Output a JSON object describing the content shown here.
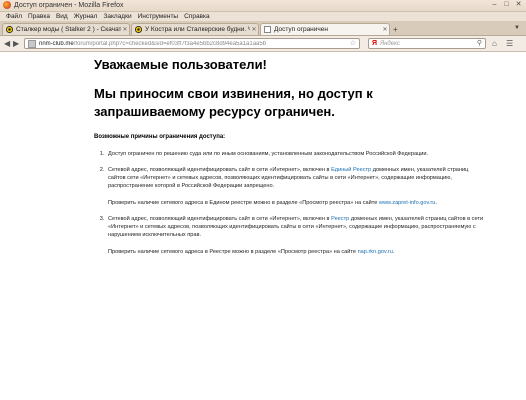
{
  "window": {
    "title": "Доступ ограничен - Mozilla Firefox",
    "controls": [
      "–",
      "□",
      "✕"
    ]
  },
  "menu": [
    "Файл",
    "Правка",
    "Вид",
    "Журнал",
    "Закладки",
    "Инструменты",
    "Справка"
  ],
  "tabs": [
    {
      "label": "Сталкер моды ( Stalker 2 ) - Скачать м...",
      "active": false,
      "icon": "radiation-icon"
    },
    {
      "label": "У Костра или Сталкерские будни. Часть...",
      "active": false,
      "icon": "radiation-icon"
    },
    {
      "label": "Доступ ограничен",
      "active": true,
      "icon": "page-icon"
    }
  ],
  "navbar": {
    "url_host": "nnm-club.me",
    "url_rest": "/forum/portal.php?c=checked&sid=ef03ff7f3a4e5bb2c8d94ea5a1a1aa5b",
    "search_logo": "Я",
    "search_placeholder": "Яндекс"
  },
  "content": {
    "greeting": "Уважаемые пользователи!",
    "apology": "Мы приносим свои извинения, но доступ к запрашиваемому ресурсу ограничен.",
    "reasons_title": "Возможные причины ограничения доступа:",
    "reasons": {
      "r1": "Доступ ограничен по решению суда или по иным основаниям, установленным законодательством Российской Федерации.",
      "r2_a": "Сетевой адрес, позволяющий идентифицировать сайт в сети «Интернет», включен в ",
      "r2_link": "Единый Реестр",
      "r2_b": " доменных имен, указателей страниц сайтов сети «Интернет» и сетевых адресов, позволяющих идентифицировать сайты в сети «Интернет», содержащие информацию, распространение которой в Российской Федерации запрещено.",
      "r2_check": "Проверить наличие сетевого адреса в Едином реестре можно в разделе «Просмотр реестра» на сайте ",
      "r2_check_link": "www.zapret-info.gov.ru",
      "r3_a": "Сетевой адрес, позволяющий идентифицировать сайт в сети «Интернет», включен в ",
      "r3_link": "Реестр",
      "r3_b": " доменных имен, указателей страниц сайтов в сети «Интернет» и сетевых адресов, позволяющих идентифицировать сайты в сети «Интернет», содержащие информацию, распространяемую с нарушением исключительных прав.",
      "r3_check": "Проверить наличие сетевого адреса в Реестре можно в разделе «Просмотр реестра» на сайте ",
      "r3_check_link": "nap.rkn.gov.ru"
    }
  }
}
